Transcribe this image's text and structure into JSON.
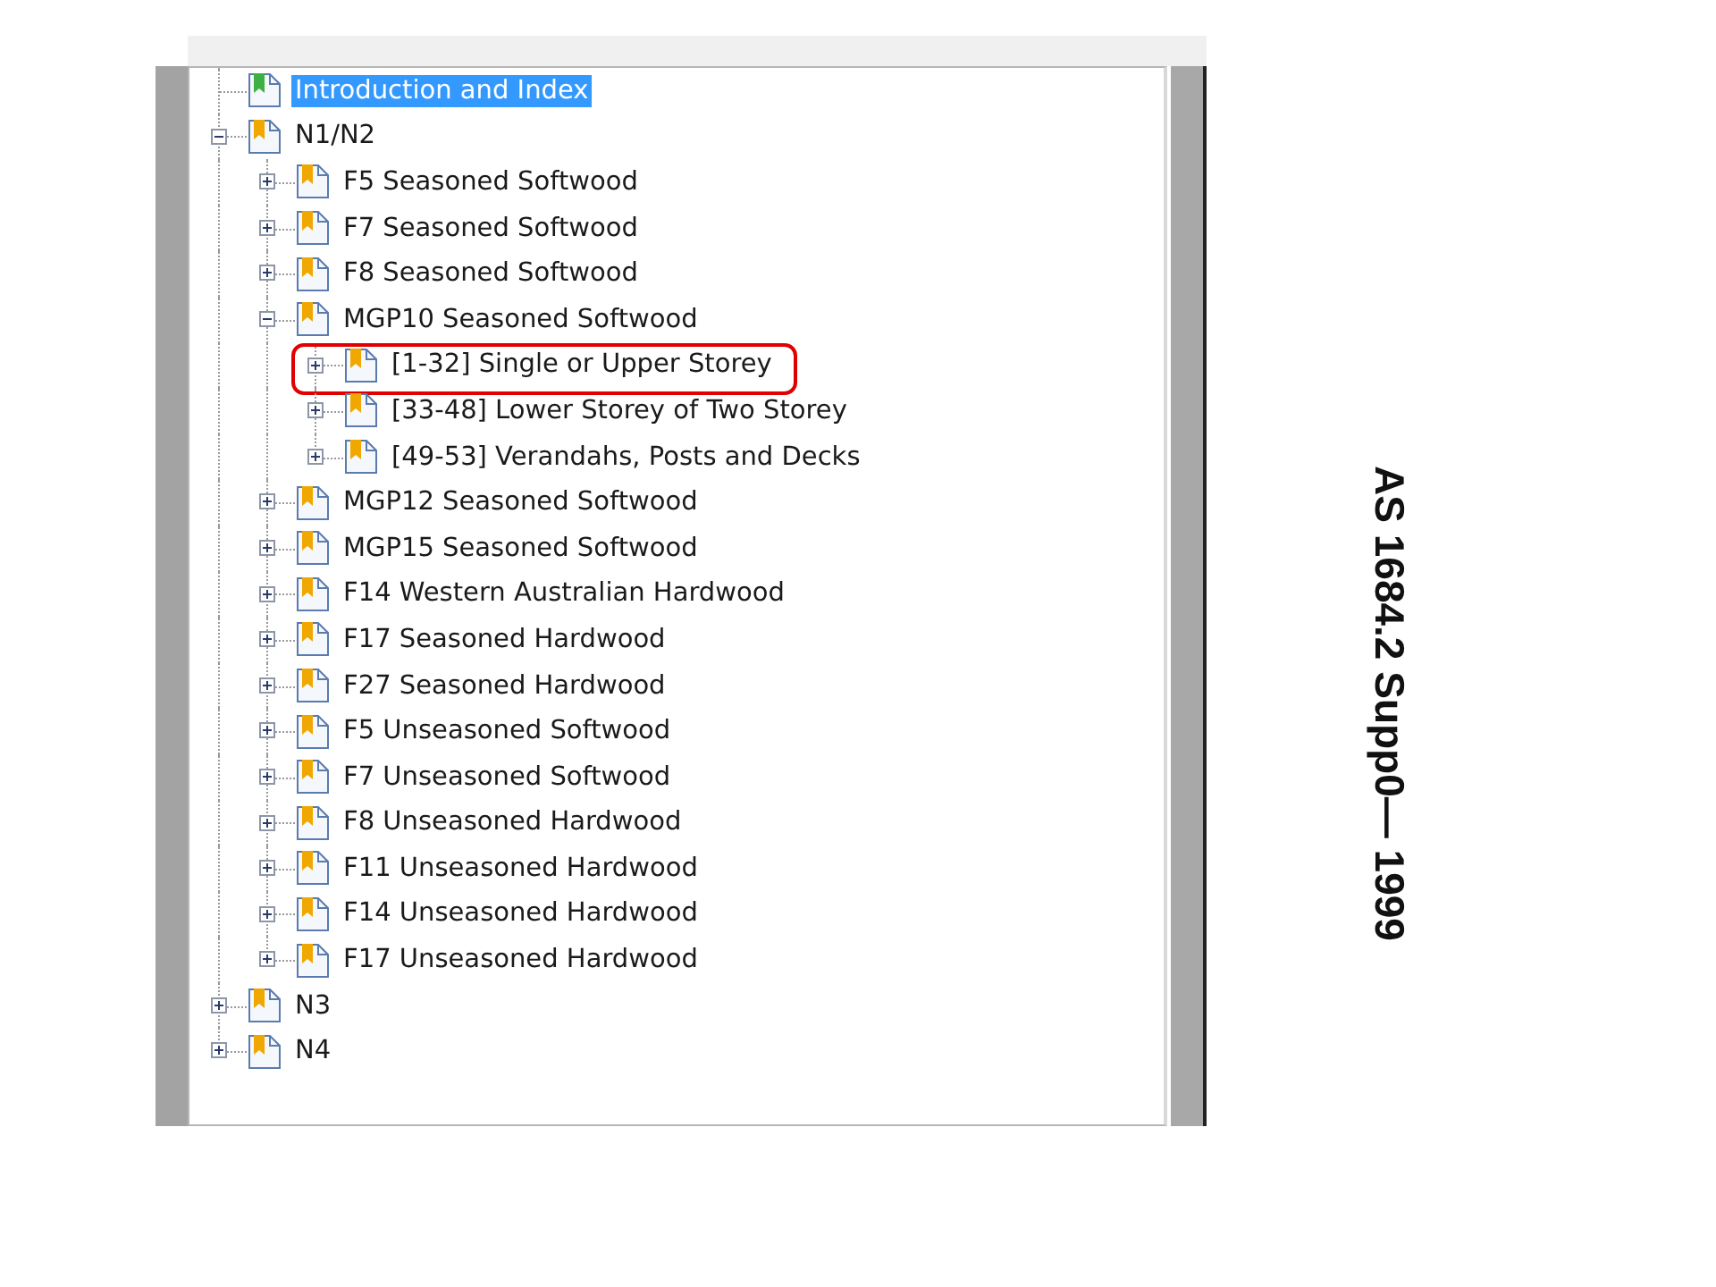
{
  "bookmarks": {
    "items": [
      {
        "label": "Introduction and Index",
        "selected": true,
        "marked": false,
        "color": "#3cb043"
      },
      {
        "label": "N1/N2",
        "selected": false,
        "marked": false,
        "color": "#f0a800",
        "expanded": true,
        "children": [
          {
            "label": "F5 Seasoned Softwood",
            "selected": false,
            "marked": false,
            "color": "#f0a800",
            "expanded": false
          },
          {
            "label": "F7 Seasoned Softwood",
            "selected": false,
            "marked": false,
            "color": "#f0a800",
            "expanded": false
          },
          {
            "label": "F8 Seasoned Softwood",
            "selected": false,
            "marked": false,
            "color": "#f0a800",
            "expanded": false
          },
          {
            "label": "MGP10 Seasoned Softwood",
            "selected": false,
            "marked": false,
            "color": "#f0a800",
            "expanded": true,
            "children": [
              {
                "label": "[1-32] Single or Upper Storey",
                "selected": false,
                "marked": true,
                "color": "#f0a800",
                "expanded": false
              },
              {
                "label": "[33-48] Lower Storey of Two Storey",
                "selected": false,
                "marked": false,
                "color": "#f0a800",
                "expanded": false
              },
              {
                "label": "[49-53] Verandahs, Posts and Decks",
                "selected": false,
                "marked": false,
                "color": "#f0a800",
                "expanded": false
              }
            ]
          },
          {
            "label": "MGP12 Seasoned Softwood",
            "selected": false,
            "marked": false,
            "color": "#f0a800",
            "expanded": false
          },
          {
            "label": "MGP15 Seasoned Softwood",
            "selected": false,
            "marked": false,
            "color": "#f0a800",
            "expanded": false
          },
          {
            "label": "F14 Western Australian Hardwood",
            "selected": false,
            "marked": false,
            "color": "#f0a800",
            "expanded": false
          },
          {
            "label": "F17 Seasoned Hardwood",
            "selected": false,
            "marked": false,
            "color": "#f0a800",
            "expanded": false
          },
          {
            "label": "F27 Seasoned Hardwood",
            "selected": false,
            "marked": false,
            "color": "#f0a800",
            "expanded": false
          },
          {
            "label": "F5 Unseasoned Softwood",
            "selected": false,
            "marked": false,
            "color": "#f0a800",
            "expanded": false
          },
          {
            "label": "F7 Unseasoned Softwood",
            "selected": false,
            "marked": false,
            "color": "#f0a800",
            "expanded": false
          },
          {
            "label": "F8 Unseasoned Hardwood",
            "selected": false,
            "marked": false,
            "color": "#f0a800",
            "expanded": false
          },
          {
            "label": "F11 Unseasoned Hardwood",
            "selected": false,
            "marked": false,
            "color": "#f0a800",
            "expanded": false
          },
          {
            "label": "F14 Unseasoned Hardwood",
            "selected": false,
            "marked": false,
            "color": "#f0a800",
            "expanded": false
          },
          {
            "label": "F17 Unseasoned Hardwood",
            "selected": false,
            "marked": false,
            "color": "#f0a800",
            "expanded": false
          }
        ]
      },
      {
        "label": "N3",
        "selected": false,
        "marked": false,
        "color": "#f0a800",
        "expanded": false
      },
      {
        "label": "N4",
        "selected": false,
        "marked": false,
        "color": "#f0a800",
        "expanded": false
      }
    ]
  },
  "side_title": "AS 1684.2 Supp0— 1999"
}
